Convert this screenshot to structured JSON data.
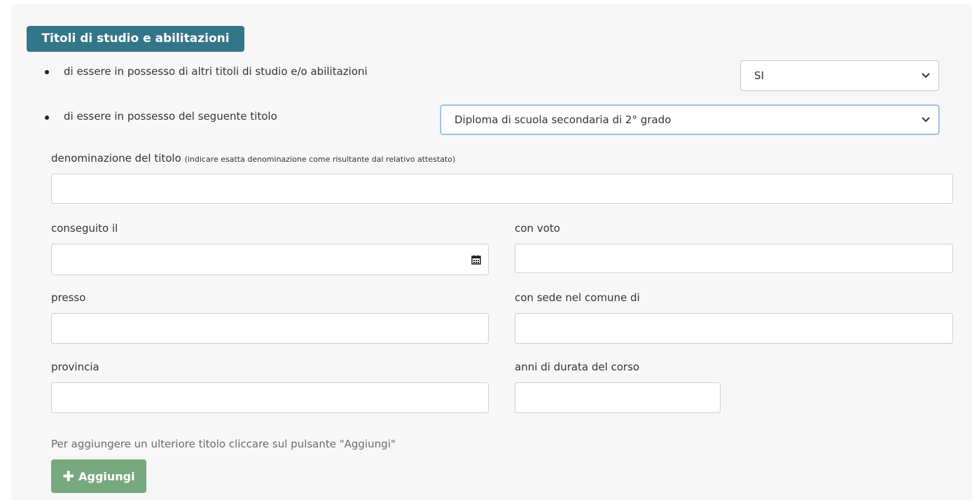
{
  "section": {
    "title": "Titoli di studio e abilitazioni"
  },
  "possesso_altri": {
    "text": "di essere in possesso di altri titoli di studio e/o abilitazioni",
    "selected": "SI"
  },
  "possesso_titolo": {
    "text": "di essere in possesso del seguente titolo",
    "selected": "Diploma di scuola secondaria di 2° grado"
  },
  "denominazione": {
    "label": "denominazione del titolo",
    "hint": "(indicare esatta denominazione come risultante dal relativo attestato)",
    "value": ""
  },
  "conseguito": {
    "label": "conseguito il",
    "value": "",
    "icon": "calendar-icon"
  },
  "voto": {
    "label": "con voto",
    "value": ""
  },
  "presso": {
    "label": "presso",
    "value": ""
  },
  "sede": {
    "label": "con sede nel comune di",
    "value": ""
  },
  "provincia": {
    "label": "provincia",
    "value": ""
  },
  "durata": {
    "label": "anni di durata del corso",
    "value": ""
  },
  "aggiungi": {
    "info": "Per aggiungere un ulteriore titolo cliccare sul pulsante \"Aggiungi\"",
    "button_label": "Aggiungi",
    "icon": "plus-icon",
    "color": "#78a87e"
  },
  "colors": {
    "title_background": "#347689",
    "panel_background": "#f7f7f7"
  }
}
